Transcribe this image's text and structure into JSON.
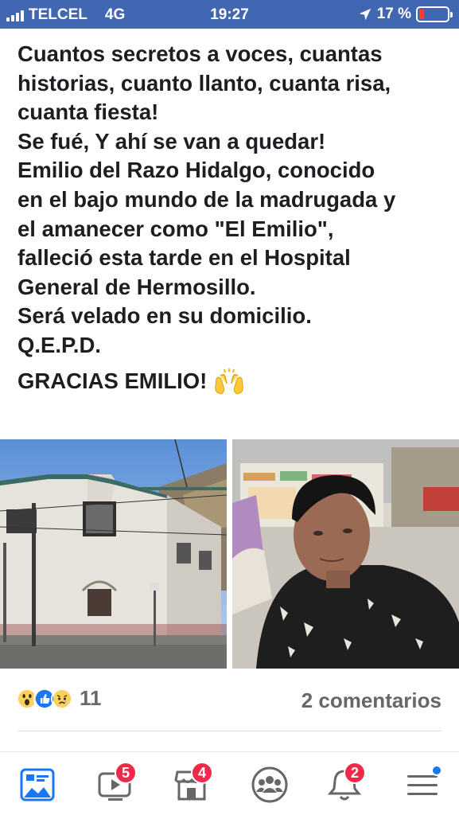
{
  "status_bar": {
    "carrier": "TELCEL",
    "network": "4G",
    "time": "19:27",
    "battery": "17 %",
    "battery_level": 0.17,
    "background_color": "#4267b2"
  },
  "post": {
    "lines": [
      "Cuantos secretos a voces, cuantas",
      "historias, cuanto llanto, cuanta risa,",
      "cuanta fiesta!",
      "Se fué, Y ahí se van a quedar!",
      "Emilio del Razo Hidalgo, conocido",
      "en el bajo mundo de la madrugada y",
      "el amanecer como \"El Emilio\",",
      "falleció esta tarde en el Hospital",
      "General de Hermosillo.",
      "Será velado en su domicilio.",
      "Q.E.P.D."
    ],
    "closing": "GRACIAS EMILIO!",
    "closing_icon": "raising-hands-emoji"
  },
  "photos": [
    {
      "subject": "old-white-house-photo"
    },
    {
      "subject": "man-portrait-photo"
    }
  ],
  "reactions": {
    "icons": [
      "wow-emoji",
      "like-icon",
      "sad-emoji"
    ],
    "count": "11",
    "comments": "2 comentarios"
  },
  "bottom_nav": {
    "items": [
      {
        "icon": "news-feed-icon",
        "badge": ""
      },
      {
        "icon": "watch-video-icon",
        "badge": "5"
      },
      {
        "icon": "marketplace-icon",
        "badge": "4"
      },
      {
        "icon": "groups-icon",
        "badge": ""
      },
      {
        "icon": "notifications-bell-icon",
        "badge": "2"
      },
      {
        "icon": "menu-icon",
        "badge": ""
      }
    ]
  }
}
